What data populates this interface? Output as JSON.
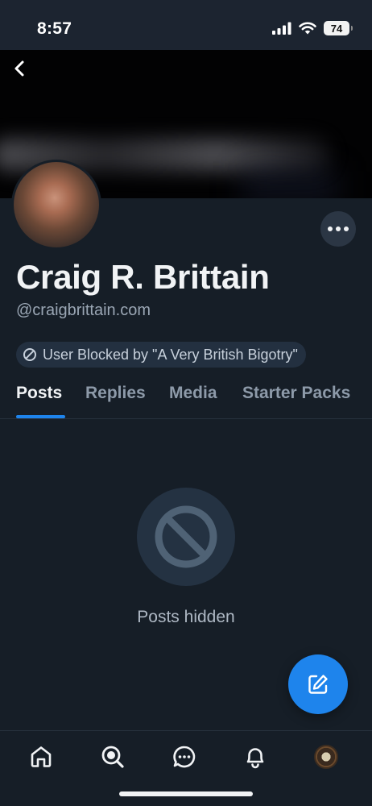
{
  "status_bar": {
    "time": "8:57",
    "battery": "74"
  },
  "profile": {
    "display_name": "Craig R. Brittain",
    "handle": "@craigbrittain.com",
    "blocked_notice": "User Blocked by \"A Very British Bigotry\""
  },
  "tabs": [
    {
      "label": "Posts",
      "active": true
    },
    {
      "label": "Replies",
      "active": false
    },
    {
      "label": "Media",
      "active": false
    },
    {
      "label": "Starter Packs",
      "active": false
    }
  ],
  "content": {
    "empty_message": "Posts hidden"
  },
  "colors": {
    "accent": "#1e84ec",
    "background": "#161e27",
    "pill": "#233040"
  },
  "icons": {
    "back": "chevron-left-icon",
    "more": "more-horizontal-icon",
    "blocked": "block-icon",
    "compose": "compose-icon",
    "nav": [
      "home-icon",
      "search-icon",
      "chat-icon",
      "bell-icon",
      "profile-avatar"
    ]
  }
}
